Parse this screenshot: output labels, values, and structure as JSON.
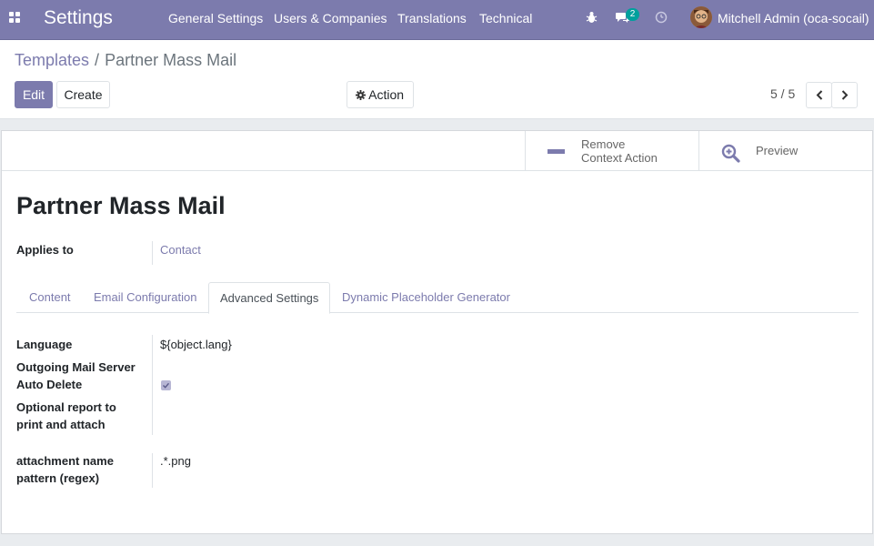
{
  "navbar": {
    "app_title": "Settings",
    "menu": [
      "General Settings",
      "Users & Companies",
      "Translations",
      "Technical"
    ],
    "icons": [
      "bug-icon",
      "chat-icon",
      "clock-icon"
    ],
    "message_count": "2",
    "user_name": "Mitchell Admin (oca-socail)",
    "color": "#7c7bad"
  },
  "breadcrumb": {
    "parent": "Templates",
    "separator": "/",
    "current": "Partner Mass Mail"
  },
  "toolbar": {
    "edit_label": "Edit",
    "create_label": "Create",
    "action_label": "Action"
  },
  "pager": {
    "value": "5 / 5"
  },
  "button_box": {
    "remove_line1": "Remove",
    "remove_line2": "Context Action",
    "preview_label": "Preview"
  },
  "record": {
    "title": "Partner Mass Mail",
    "applies_to_label": "Applies to",
    "applies_to_value": "Contact"
  },
  "tabs": [
    {
      "label": "Content",
      "active": false
    },
    {
      "label": "Email Configuration",
      "active": false
    },
    {
      "label": "Advanced Settings",
      "active": true
    },
    {
      "label": "Dynamic Placeholder Generator",
      "active": false
    }
  ],
  "advanced": {
    "language_label": "Language",
    "language_value": "${object.lang}",
    "mail_server_label": "Outgoing Mail Server",
    "auto_delete_label": "Auto Delete",
    "auto_delete_checked": true,
    "report_label_line1": "Optional report to",
    "report_label_line2": "print and attach",
    "attachment_label_line1": "attachment name",
    "attachment_label_line2": "pattern (regex)",
    "attachment_value": ".*.png"
  }
}
